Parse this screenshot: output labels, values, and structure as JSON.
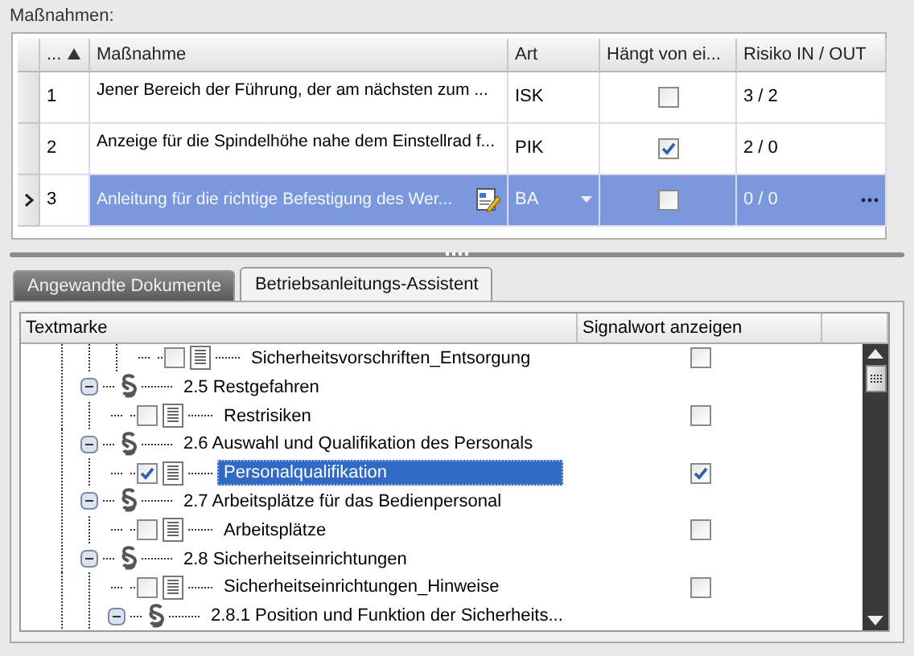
{
  "measures_label": "Maßnahmen:",
  "grid": {
    "columns": [
      {
        "label": "...",
        "sorted": true
      },
      {
        "label": "Maßnahme",
        "sorted": false
      },
      {
        "label": "Art",
        "sorted": false
      },
      {
        "label": "Hängt von ei...",
        "sorted": false
      },
      {
        "label": "Risiko IN / OUT",
        "sorted": false
      }
    ],
    "rows": [
      {
        "number": "1",
        "measure": "Jener Bereich der Führung, der am nächsten zum ...",
        "type": "ISK",
        "depends": false,
        "risk": "3 / 2",
        "selected": false
      },
      {
        "number": "2",
        "measure": "Anzeige für die Spindelhöhe nahe dem Einstellrad f...",
        "type": "PIK",
        "depends": true,
        "risk": "2 / 0",
        "selected": false
      },
      {
        "number": "3",
        "measure": "Anleitung für die richtige Befestigung des Wer...",
        "type": "BA",
        "depends": false,
        "risk": "0 / 0",
        "selected": true
      }
    ]
  },
  "tabs": [
    {
      "label": "Angewandte Dokumente",
      "selected": false
    },
    {
      "label": "Betriebsanleitungs-Assistent",
      "selected": true
    }
  ],
  "tree": {
    "columns": [
      "Textmarke",
      "Signalwort anzeigen"
    ],
    "continued": [
      {
        "kind": "item",
        "label": "Sicherheitsvorschriften_Entsorgung",
        "checked": false,
        "signal": false,
        "selected": false
      }
    ],
    "sections": [
      {
        "kind": "section",
        "label": "2.5 Restgefahren",
        "expanded": true,
        "children": [
          {
            "kind": "item",
            "label": "Restrisiken",
            "checked": false,
            "signal": false,
            "selected": false
          }
        ]
      },
      {
        "kind": "section",
        "label": "2.6 Auswahl und Qualifikation des Personals",
        "expanded": true,
        "children": [
          {
            "kind": "item",
            "label": "Personalqualifikation",
            "checked": true,
            "signal": true,
            "selected": true
          }
        ]
      },
      {
        "kind": "section",
        "label": "2.7 Arbeitsplätze für das Bedienpersonal",
        "expanded": true,
        "children": [
          {
            "kind": "item",
            "label": "Arbeitsplätze",
            "checked": false,
            "signal": false,
            "selected": false
          }
        ]
      },
      {
        "kind": "section",
        "label": "2.8 Sicherheitseinrichtungen",
        "expanded": true,
        "children": [
          {
            "kind": "item",
            "label": "Sicherheitseinrichtungen_Hinweise",
            "checked": false,
            "signal": false,
            "selected": false
          },
          {
            "kind": "section",
            "label": "2.8.1 Position und Funktion der Sicherheits...",
            "expanded": true
          }
        ]
      }
    ]
  }
}
